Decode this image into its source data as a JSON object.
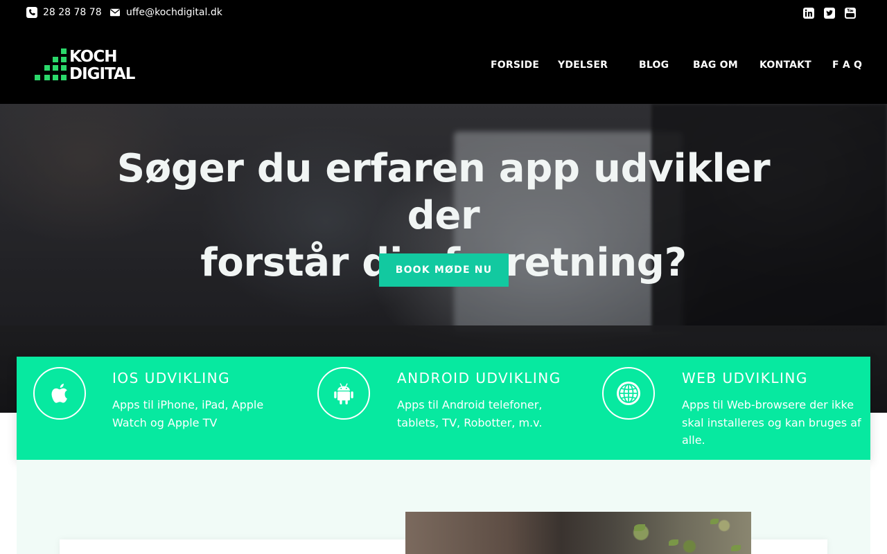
{
  "topbar": {
    "phone": "28 28 78 78",
    "email": "uffe@kochdigital.dk",
    "social": [
      "linkedin-icon",
      "twitter-icon",
      "youtube-icon"
    ]
  },
  "header": {
    "logo_line1": "KOCH",
    "logo_line2": "DIGITAL",
    "nav": [
      "FORSIDE",
      "YDELSER",
      "BLOG",
      "BAG OM",
      "KONTAKT",
      "F A Q"
    ]
  },
  "hero": {
    "title_line1": "Søger du erfaren app udvikler der",
    "title_line2": "forstår din forretning?",
    "cta": "BOOK MØDE NU"
  },
  "services": [
    {
      "icon": "apple-icon",
      "title": "IOS UDVIKLING",
      "text": "Apps til iPhone, iPad, Apple Watch og Apple TV"
    },
    {
      "icon": "android-icon",
      "title": "ANDROID UDVIKLING",
      "text": "Apps til Android telefoner, tablets, TV, Robotter, m.v."
    },
    {
      "icon": "globe-icon",
      "title": "WEB UDVIKLING",
      "text": "Apps til Web-browsere der ikke skal installeres og kan bruges af alle."
    }
  ],
  "colors": {
    "accent": "#07e9a0",
    "cta": "#12c9a0",
    "topbar": "#000000",
    "section_bg": "#f1fbf7",
    "logo_green": "#2bd86a"
  }
}
